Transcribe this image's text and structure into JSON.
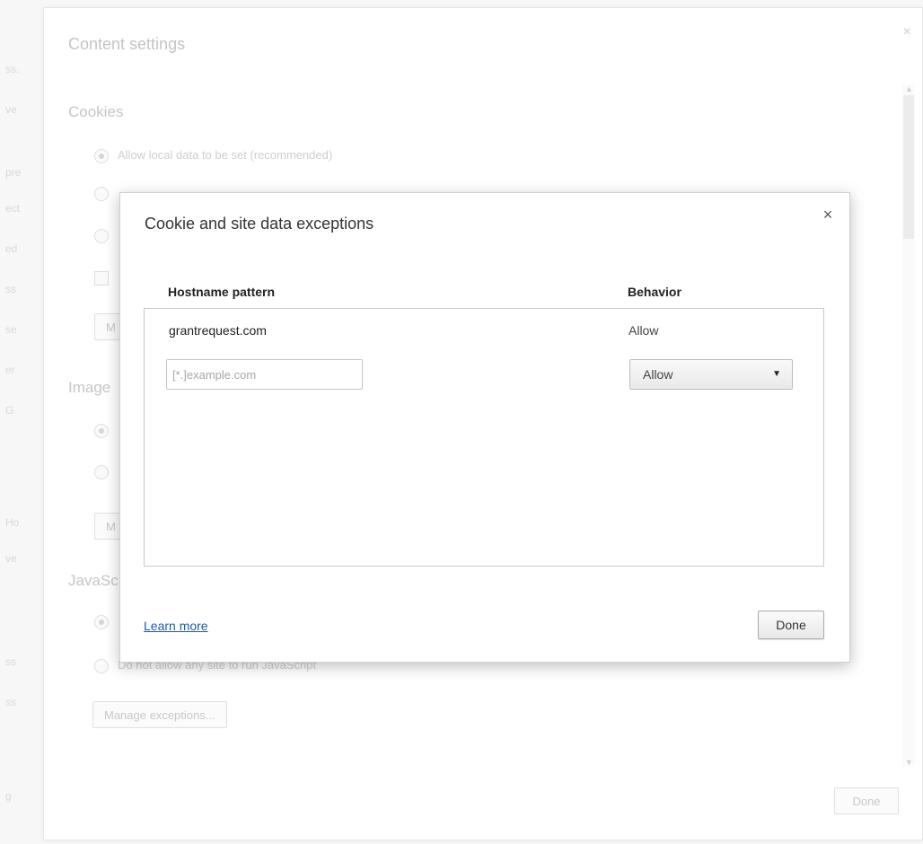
{
  "outer_dialog": {
    "title": "Content settings",
    "close_glyph": "×",
    "sections": {
      "cookies": {
        "title": "Cookies",
        "option_allow": "Allow local data to be set (recommended)"
      },
      "images": {
        "title": "Image",
        "manage_partial": "M"
      },
      "javascript": {
        "title": "JavaSc",
        "option_block": "Do not allow any site to run JavaScript",
        "manage_label": "Manage exceptions..."
      },
      "cookies_manage_partial": "M"
    },
    "done_label": "Done"
  },
  "modal": {
    "title": "Cookie and site data exceptions",
    "close_glyph": "×",
    "columns": {
      "hostname": "Hostname pattern",
      "behavior": "Behavior"
    },
    "rows": [
      {
        "hostname": "grantrequest.com",
        "behavior": "Allow"
      }
    ],
    "new_entry": {
      "placeholder": "[*.]example.com",
      "value": "",
      "behavior_selected": "Allow"
    },
    "learn_more": "Learn more",
    "done_label": "Done"
  },
  "icons": {
    "close": "close-icon",
    "dropdown_arrow": "triangle-down-icon"
  },
  "colors": {
    "link": "#1f5aa8",
    "modal_border": "#cfcfcf"
  }
}
